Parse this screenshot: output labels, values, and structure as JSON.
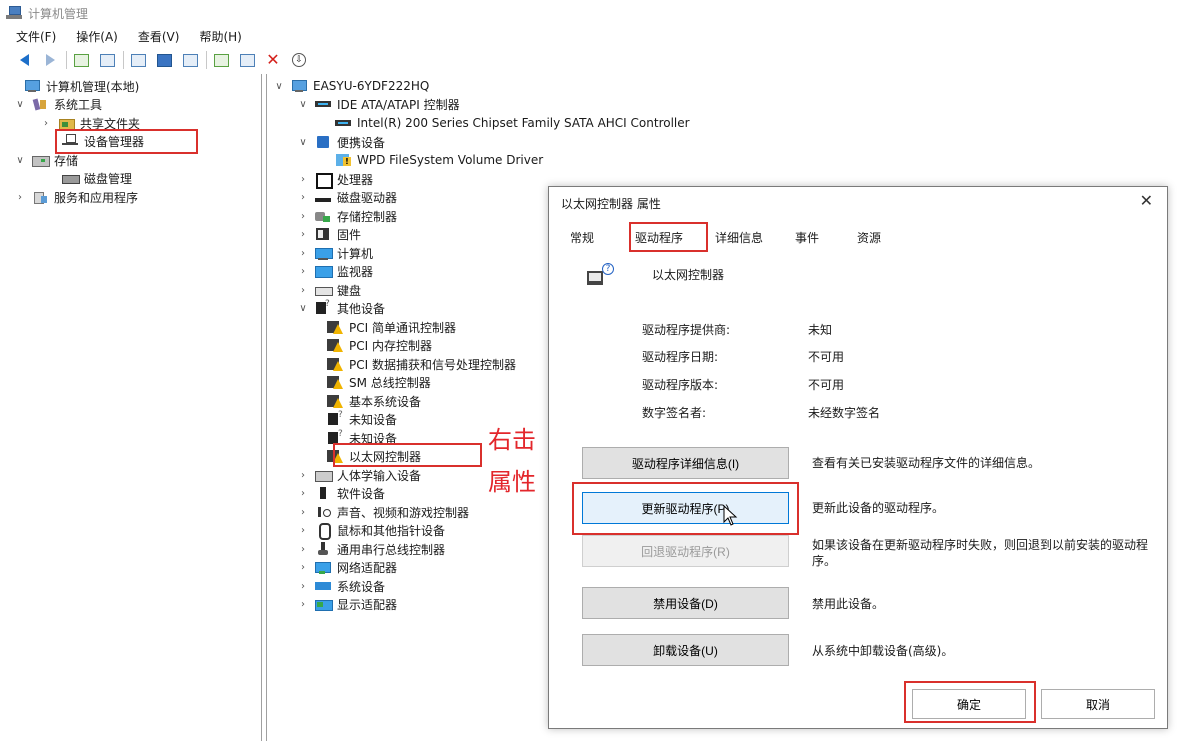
{
  "window": {
    "title": "计算机管理"
  },
  "menu": [
    "文件(F)",
    "操作(A)",
    "查看(V)",
    "帮助(H)"
  ],
  "left_tree": [
    {
      "label": "计算机管理(本地)",
      "icon": "computer-management-icon"
    },
    {
      "label": "系统工具",
      "icon": "system-tools-icon"
    },
    {
      "label": "共享文件夹",
      "icon": "shared-folders-icon"
    },
    {
      "label": "设备管理器",
      "icon": "device-manager-icon"
    },
    {
      "label": "存储",
      "icon": "storage-icon"
    },
    {
      "label": "磁盘管理",
      "icon": "disk-management-icon"
    },
    {
      "label": "服务和应用程序",
      "icon": "services-icon"
    }
  ],
  "device_tree": [
    {
      "label": "EASYU-6YDF222HQ"
    },
    {
      "label": "IDE ATA/ATAPI 控制器"
    },
    {
      "label": "Intel(R) 200 Series Chipset Family SATA AHCI Controller"
    },
    {
      "label": "便携设备"
    },
    {
      "label": "WPD FileSystem Volume Driver"
    },
    {
      "label": "处理器"
    },
    {
      "label": "磁盘驱动器"
    },
    {
      "label": "存储控制器"
    },
    {
      "label": "固件"
    },
    {
      "label": "计算机"
    },
    {
      "label": "监视器"
    },
    {
      "label": "键盘"
    },
    {
      "label": "其他设备"
    },
    {
      "label": "PCI 简单通讯控制器"
    },
    {
      "label": "PCI 内存控制器"
    },
    {
      "label": "PCI 数据捕获和信号处理控制器"
    },
    {
      "label": "SM 总线控制器"
    },
    {
      "label": "基本系统设备"
    },
    {
      "label": "未知设备"
    },
    {
      "label": "未知设备"
    },
    {
      "label": "以太网控制器"
    },
    {
      "label": "人体学输入设备"
    },
    {
      "label": "软件设备"
    },
    {
      "label": "声音、视频和游戏控制器"
    },
    {
      "label": "鼠标和其他指针设备"
    },
    {
      "label": "通用串行总线控制器"
    },
    {
      "label": "网络适配器"
    },
    {
      "label": "系统设备"
    },
    {
      "label": "显示适配器"
    }
  ],
  "annotation": {
    "line1": "右击",
    "line2": "属性"
  },
  "dialog": {
    "title": "以太网控制器 属性",
    "close": "✕",
    "tabs": [
      "常规",
      "驱动程序",
      "详细信息",
      "事件",
      "资源"
    ],
    "device_name": "以太网控制器",
    "properties": [
      {
        "label": "驱动程序提供商:",
        "value": "未知"
      },
      {
        "label": "驱动程序日期:",
        "value": "不可用"
      },
      {
        "label": "驱动程序版本:",
        "value": "不可用"
      },
      {
        "label": "数字签名者:",
        "value": "未经数字签名"
      }
    ],
    "buttons": [
      {
        "label": "驱动程序详细信息(I)",
        "desc": "查看有关已安装驱动程序文件的详细信息。"
      },
      {
        "label": "更新驱动程序(P)",
        "desc": "更新此设备的驱动程序。"
      },
      {
        "label": "回退驱动程序(R)",
        "desc": "如果该设备在更新驱动程序时失败，则回退到以前安装的驱动程序。"
      },
      {
        "label": "禁用设备(D)",
        "desc": "禁用此设备。"
      },
      {
        "label": "卸载设备(U)",
        "desc": "从系统中卸载设备(高级)。"
      }
    ],
    "ok": "确定",
    "cancel": "取消"
  },
  "colors": {
    "highlight_box": "#d9302c",
    "annotation_text": "#e3262b"
  }
}
